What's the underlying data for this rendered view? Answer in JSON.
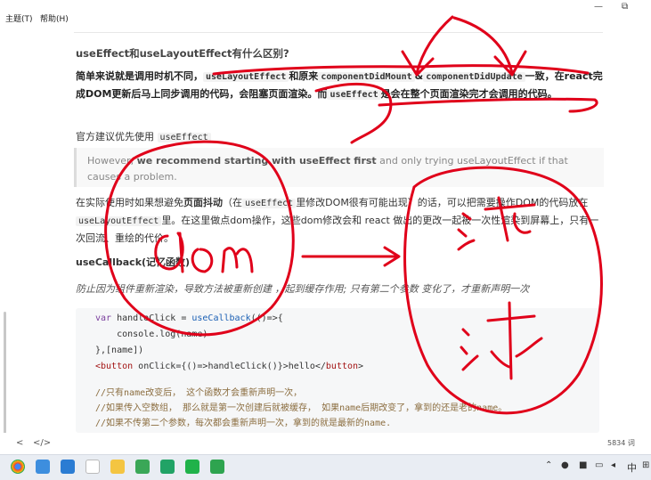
{
  "menu": {
    "theme": "主题(T)",
    "help": "帮助(H)"
  },
  "window_buttons": {
    "minimize": "—",
    "restore": "⧉"
  },
  "doc": {
    "heading": "useEffect和useLayoutEffect有什么区别?",
    "para1": {
      "t1": "简单来说就是调用时机不同，",
      "c1": "useLayoutEffect",
      "t2": "和原来",
      "c2": "componentDidMount",
      "t3": "&",
      "c3": "componentDidUpdate",
      "t4": "一致，在react完成DOM更新后马上同步调用的代码，会阻塞页面渲染。而",
      "c4": "useEffect",
      "t5": "是会在整个页面渲染完才会调用的代码。"
    },
    "para2": {
      "t1": "官方建议优先使用",
      "c1": "useEffect"
    },
    "quote": {
      "t1": "However, ",
      "b1": "we recommend starting with useEffect first",
      "t2": " and only trying useLayoutEffect if that causes a problem."
    },
    "para3": {
      "t1": "在实际使用时如果想避免",
      "b1": "页面抖动",
      "t2": "（在",
      "c1": "useEffect",
      "t3": "里修改DOM很有可能出现）的话，可以把需要操作DOM的代码放在",
      "c2": "useLayoutEffect",
      "t4": "里。在这里做点dom操作，这些dom修改会和 react 做出的更改一起被一次性渲染到屏幕上，只有一次回流、重绘的代价。"
    },
    "h4": "useCallback(记忆函数)",
    "para4": "防止因为组件重新渲染，导致方法被重新创建 ，起到缓存作用; 只有第二个参数 变化了，才重新声明一次",
    "code": {
      "l1a": "var",
      "l1b": " handleClick = ",
      "l1c": "useCallback",
      "l1d": "(()=>{",
      "l2": "    console.log(name)",
      "l3": "},[name])",
      "l4a": "<button",
      "l4b": " onClick={()=>handleClick()}>hello</",
      "l4c": "button",
      "l4d": ">",
      "c1": "//只有name改变后， 这个函数才会重新声明一次，",
      "c2": "//如果传入空数组， 那么就是第一次创建后就被缓存， 如果name后期改变了，拿到的还是老的name。",
      "c3": "//如果不传第二个参数，每次都会重新声明一次，拿到的就是最新的name."
    }
  },
  "bottom_bar": {
    "back": "<",
    "source": "</>",
    "wordcount": "5834 词"
  },
  "taskbar": {
    "lang": "中"
  },
  "annotation": {
    "left_word": "dom",
    "right_word": "渲染"
  },
  "colors": {
    "ink": "#e0001a",
    "code_bg": "#f6f7f8"
  }
}
